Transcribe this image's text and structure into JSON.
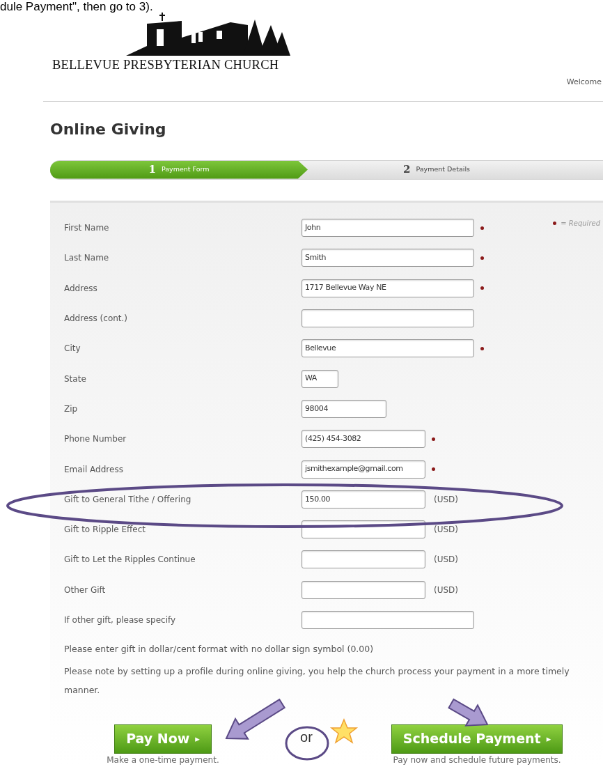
{
  "caption": "dule Payment\", then go to 3).",
  "logo": {
    "name": "BELLEVUE PRESBYTERIAN CHURCH"
  },
  "welcome": "Welcome",
  "page_title": "Online Giving",
  "steps": [
    {
      "number": "1",
      "label": "Payment Form",
      "selected": true
    },
    {
      "number": "2",
      "label": "Payment Details",
      "selected": false
    }
  ],
  "required_legend": "= Required",
  "fields": [
    {
      "label": "First Name",
      "value": "John",
      "kind": "long",
      "required": true
    },
    {
      "label": "Last Name",
      "value": "Smith",
      "kind": "long",
      "required": true
    },
    {
      "label": "Address",
      "value": "1717 Bellevue Way NE",
      "kind": "long",
      "required": true
    },
    {
      "label": "Address (cont.)",
      "kind": "long",
      "required": false
    },
    {
      "label": "City",
      "value": "Bellevue",
      "kind": "long",
      "required": true
    },
    {
      "label": "State",
      "value": "WA",
      "kind": "tiny",
      "required": false
    },
    {
      "label": "Zip",
      "value": "98004",
      "kind": "short",
      "required": false
    },
    {
      "label": "Phone Number",
      "value": "(425) 454-3082",
      "kind": "medium",
      "required": true
    },
    {
      "label": "Email Address",
      "value": "jsmithexample@gmail.com",
      "kind": "medium",
      "required": true
    },
    {
      "label": "Gift to General Tithe / Offering",
      "value": "150.00",
      "kind": "medium",
      "required": false,
      "suffix": "(USD)"
    },
    {
      "label": "Gift to Ripple Effect",
      "kind": "medium",
      "required": false,
      "suffix": "(USD)"
    },
    {
      "label": "Gift to Let the Ripples Continue",
      "kind": "medium",
      "required": false,
      "suffix": "(USD)"
    },
    {
      "label": "Other Gift",
      "kind": "medium",
      "required": false,
      "suffix": "(USD)"
    },
    {
      "label": "If other gift, please specify",
      "kind": "long",
      "required": false
    }
  ],
  "notes": [
    "Please enter gift in dollar/cent format with no dollar sign symbol (0.00)",
    "Please note by setting up a profile during online giving, you help the church process your payment in a more timely manner."
  ],
  "actions": [
    {
      "label": "Pay Now",
      "arrow": "▸",
      "caption": "Make a one-time payment."
    },
    {
      "label": "Schedule Payment",
      "arrow": "▸",
      "caption": "Pay now and schedule future payments."
    }
  ],
  "separator": "or"
}
